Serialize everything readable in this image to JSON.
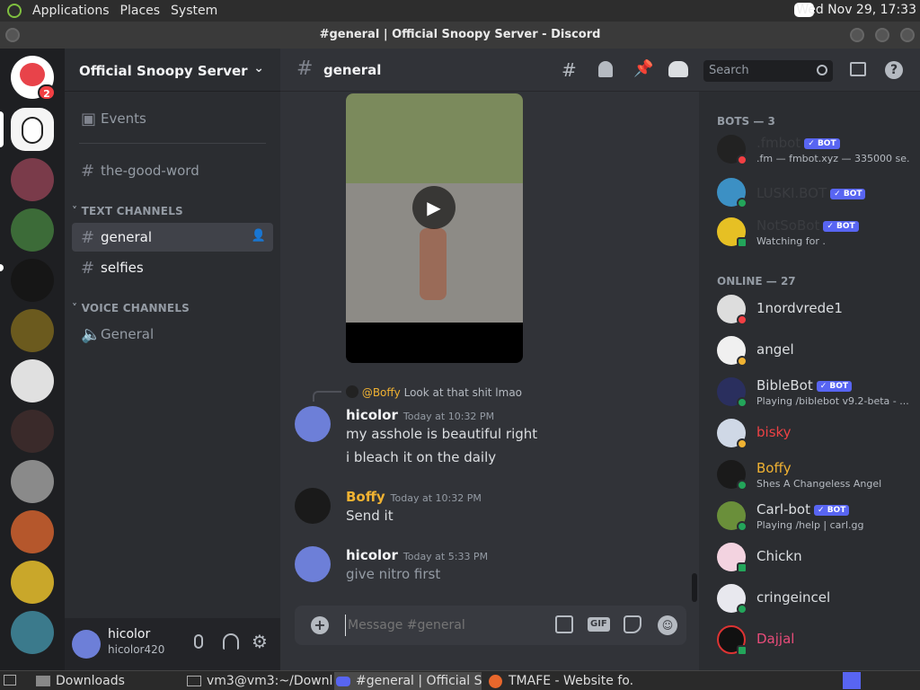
{
  "system_bar": {
    "menus": [
      "Applications",
      "Places",
      "System"
    ],
    "clock": "Wed Nov 29, 17:33"
  },
  "window": {
    "title": "#general | Official Snoopy Server - Discord"
  },
  "guilds": {
    "home_badge": "2"
  },
  "server": {
    "name": "Official Snoopy Server",
    "events_label": "Events",
    "top_channel": "the-good-word",
    "text_category": "TEXT CHANNELS",
    "text_channels": [
      "general",
      "selfies"
    ],
    "voice_category": "VOICE CHANNELS",
    "voice_channels": [
      "General"
    ]
  },
  "user_panel": {
    "display_name": "hicolor",
    "username": "hicolor420"
  },
  "channel_header": {
    "name": "general",
    "search_placeholder": "Search"
  },
  "messages": {
    "reply_to": "@Boffy",
    "reply_text": "Look at that shit lmao",
    "m1": {
      "author": "hicolor",
      "time": "Today at 10:32 PM",
      "lines": [
        "my asshole is beautiful right",
        "i bleach it on the daily"
      ]
    },
    "m2": {
      "author": "Boffy",
      "time": "Today at 10:32 PM",
      "lines": [
        "Send it"
      ]
    },
    "m3": {
      "author": "hicolor",
      "time": "Today at 5:33 PM",
      "lines": [
        "give nitro first"
      ]
    }
  },
  "composer": {
    "placeholder": "Message #general",
    "gif_label": "GIF"
  },
  "members": {
    "bots_header": "BOTS — 3",
    "online_header": "ONLINE — 27",
    "bot_label": "BOT",
    "bots": [
      {
        "name": ".fmbot",
        "status": ".fm — fmbot.xyz — 335000 se..."
      },
      {
        "name": "LUSKI.BOT",
        "status": ""
      },
      {
        "name": "NotSoBot",
        "status": "Watching for ."
      }
    ],
    "online": [
      {
        "name": "1nordvrede1",
        "status": ""
      },
      {
        "name": "angel",
        "status": ""
      },
      {
        "name": "BibleBot",
        "status": "Playing /biblebot v9.2-beta - ...",
        "bot": true
      },
      {
        "name": "bisky",
        "status": ""
      },
      {
        "name": "Boffy",
        "status": "Shes A Changeless Angel"
      },
      {
        "name": "Carl-bot",
        "status": "Playing /help | carl.gg",
        "bot": true
      },
      {
        "name": "Chickn",
        "status": ""
      },
      {
        "name": "cringeincel",
        "status": ""
      },
      {
        "name": "Dajjal",
        "status": ""
      }
    ]
  },
  "taskbar": {
    "items": [
      "Downloads",
      "vm3@vm3:~/Downl...",
      "#general | Official S...",
      "TMAFE - Website fo..."
    ]
  },
  "colors": {
    "blurple": "#5865f2",
    "online": "#23a55a",
    "dnd": "#f23f43",
    "idle": "#f0b232",
    "boffy_gold": "#f0b232",
    "bisky_red": "#ed4245"
  }
}
